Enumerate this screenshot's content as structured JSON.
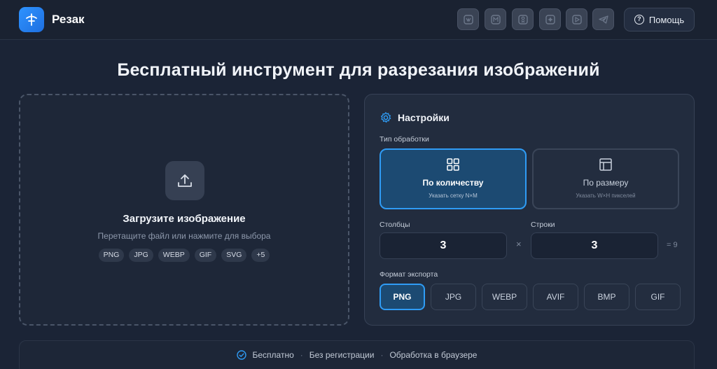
{
  "header": {
    "brand": "Резак",
    "social_icons": [
      "vk-icon",
      "max-icon",
      "odnoklassniki-icon",
      "zen-icon",
      "rutube-icon",
      "telegram-icon"
    ],
    "help_label": "Помощь"
  },
  "page_title": "Бесплатный инструмент для разрезания изображений",
  "upload": {
    "title": "Загрузите изображение",
    "subtitle": "Перетащите файл или нажмите для выбора",
    "formats": [
      "PNG",
      "JPG",
      "WEBP",
      "GIF",
      "SVG",
      "+5"
    ]
  },
  "settings": {
    "title": "Настройки",
    "processing_label": "Тип обработки",
    "modes": [
      {
        "title": "По количеству",
        "subtitle": "Указать сетку N×M",
        "active": true
      },
      {
        "title": "По размеру",
        "subtitle": "Указать W×H пикселей",
        "active": false
      }
    ],
    "columns_label": "Столбцы",
    "columns_value": "3",
    "rows_label": "Строки",
    "rows_value": "3",
    "times_sign": "×",
    "total": "= 9",
    "export_label": "Формат экспорта",
    "export_formats": [
      "PNG",
      "JPG",
      "WEBP",
      "AVIF",
      "BMP",
      "GIF"
    ],
    "export_selected": "PNG"
  },
  "footer": {
    "items": [
      "Бесплатно",
      "Без регистрации",
      "Обработка в браузере"
    ]
  },
  "colors": {
    "accent": "#2f9cf5",
    "background": "#1b2436",
    "active_card": "#1c4a72"
  }
}
